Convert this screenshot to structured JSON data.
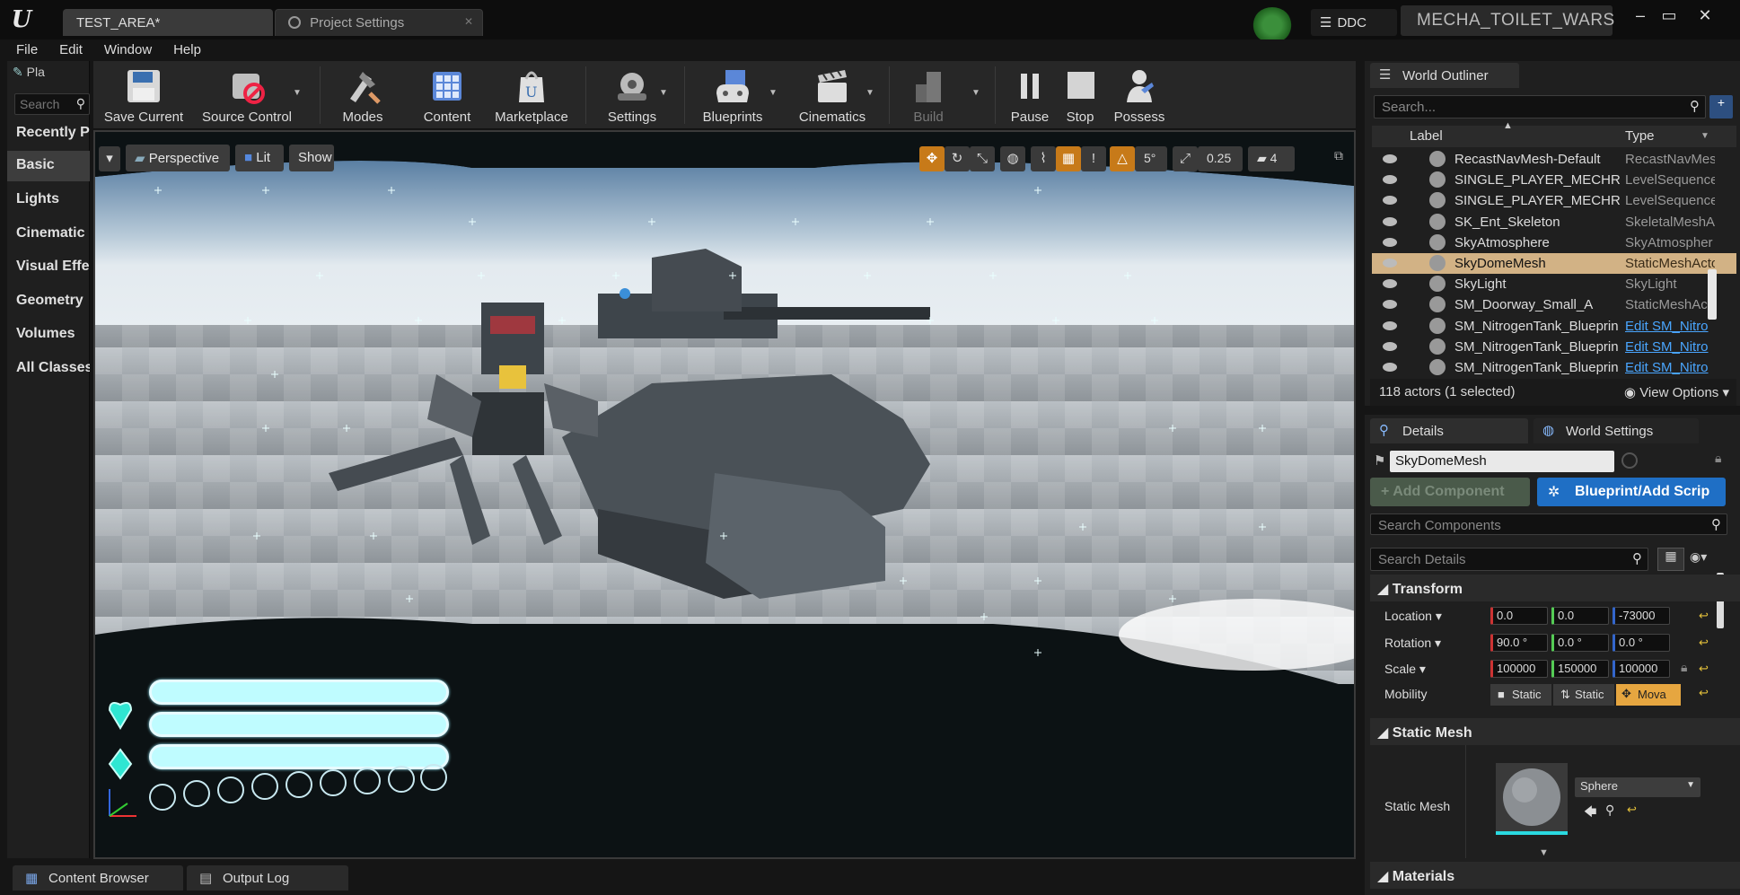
{
  "title_bar": {
    "tabs": [
      {
        "label": "TEST_AREA*"
      },
      {
        "label": "Project Settings"
      }
    ],
    "ddc_label": "DDC",
    "project_name": "MECHA_TOILET_WARS",
    "controls": [
      "–",
      "▭",
      "✕"
    ]
  },
  "menu": [
    "File",
    "Edit",
    "Window",
    "Help"
  ],
  "place_panel": {
    "tab_label": "Pla",
    "search_placeholder": "Search",
    "categories": [
      "Recently P",
      "Basic",
      "Lights",
      "Cinematic",
      "Visual Effe",
      "Geometry",
      "Volumes",
      "All Classes"
    ],
    "selected_category": "Basic"
  },
  "toolbar": {
    "buttons": [
      {
        "label": "Save Current",
        "icon": "save-icon"
      },
      {
        "label": "Source Control",
        "icon": "source-control-icon"
      },
      {
        "label": "Modes",
        "icon": "modes-icon"
      },
      {
        "label": "Content",
        "icon": "content-icon"
      },
      {
        "label": "Marketplace",
        "icon": "marketplace-icon"
      },
      {
        "label": "Settings",
        "icon": "settings-icon"
      },
      {
        "label": "Blueprints",
        "icon": "blueprints-icon"
      },
      {
        "label": "Cinematics",
        "icon": "cinematics-icon"
      },
      {
        "label": "Build",
        "icon": "build-icon"
      },
      {
        "label": "Pause",
        "icon": "pause-icon"
      },
      {
        "label": "Stop",
        "icon": "stop-icon"
      },
      {
        "label": "Possess",
        "icon": "possess-icon"
      }
    ]
  },
  "viewport": {
    "perspective_label": "Perspective",
    "lit_label": "Lit",
    "show_label": "Show",
    "rotation_snap": "5°",
    "scale_snap": "0.25",
    "camera_speed": "4",
    "colors": {
      "hud_bar": "#bffcff",
      "hud_diamond": "#2fe6d2"
    }
  },
  "world_outliner": {
    "tab_label": "World Outliner",
    "search_placeholder": "Search...",
    "col_label": "Label",
    "col_type": "Type",
    "rows": [
      {
        "label": "RecastNavMesh-Default",
        "type": "RecastNavMes",
        "link": false
      },
      {
        "label": "SINGLE_PLAYER_MECHRO",
        "type": "LevelSequence",
        "link": false
      },
      {
        "label": "SINGLE_PLAYER_MECHRO",
        "type": "LevelSequence",
        "link": false
      },
      {
        "label": "SK_Ent_Skeleton",
        "type": "SkeletalMeshA",
        "link": false
      },
      {
        "label": "SkyAtmosphere",
        "type": "SkyAtmospher",
        "link": false
      },
      {
        "label": "SkyDomeMesh",
        "type": "StaticMeshActo",
        "link": false
      },
      {
        "label": "SkyLight",
        "type": "SkyLight",
        "link": false
      },
      {
        "label": "SM_Doorway_Small_A",
        "type": "StaticMeshActo",
        "link": false
      },
      {
        "label": "SM_NitrogenTank_Blueprin",
        "type": "Edit SM_Nitro",
        "link": true
      },
      {
        "label": "SM_NitrogenTank_Blueprin",
        "type": "Edit SM_Nitro",
        "link": true
      },
      {
        "label": "SM_NitrogenTank_Blueprin",
        "type": "Edit SM_Nitro",
        "link": true
      }
    ],
    "selected_row": "SkyDomeMesh",
    "actor_count": "118 actors (1 selected)",
    "view_options": "View Options"
  },
  "details": {
    "tab_label": "Details",
    "world_settings_label": "World Settings",
    "actor_name": "SkyDomeMesh",
    "add_component": "+ Add Component",
    "blueprint_btn": "Blueprint/Add Scrip",
    "search_components": "Search Components",
    "search_details": "Search Details",
    "transform_header": "Transform",
    "location_label": "Location",
    "rotation_label": "Rotation",
    "scale_label": "Scale",
    "mobility_label": "Mobility",
    "location": [
      "0.0",
      "0.0",
      "-73000"
    ],
    "rotation": [
      "90.0 °",
      "0.0 °",
      "0.0 °"
    ],
    "scale": [
      "100000",
      "150000",
      "100000"
    ],
    "mobility_options": [
      "Static",
      "Static",
      "Mova"
    ],
    "static_mesh_header": "Static Mesh",
    "static_mesh_label": "Static Mesh",
    "static_mesh_value": "Sphere",
    "materials_header": "Materials"
  },
  "bottom_tabs": [
    "Content Browser",
    "Output Log"
  ]
}
